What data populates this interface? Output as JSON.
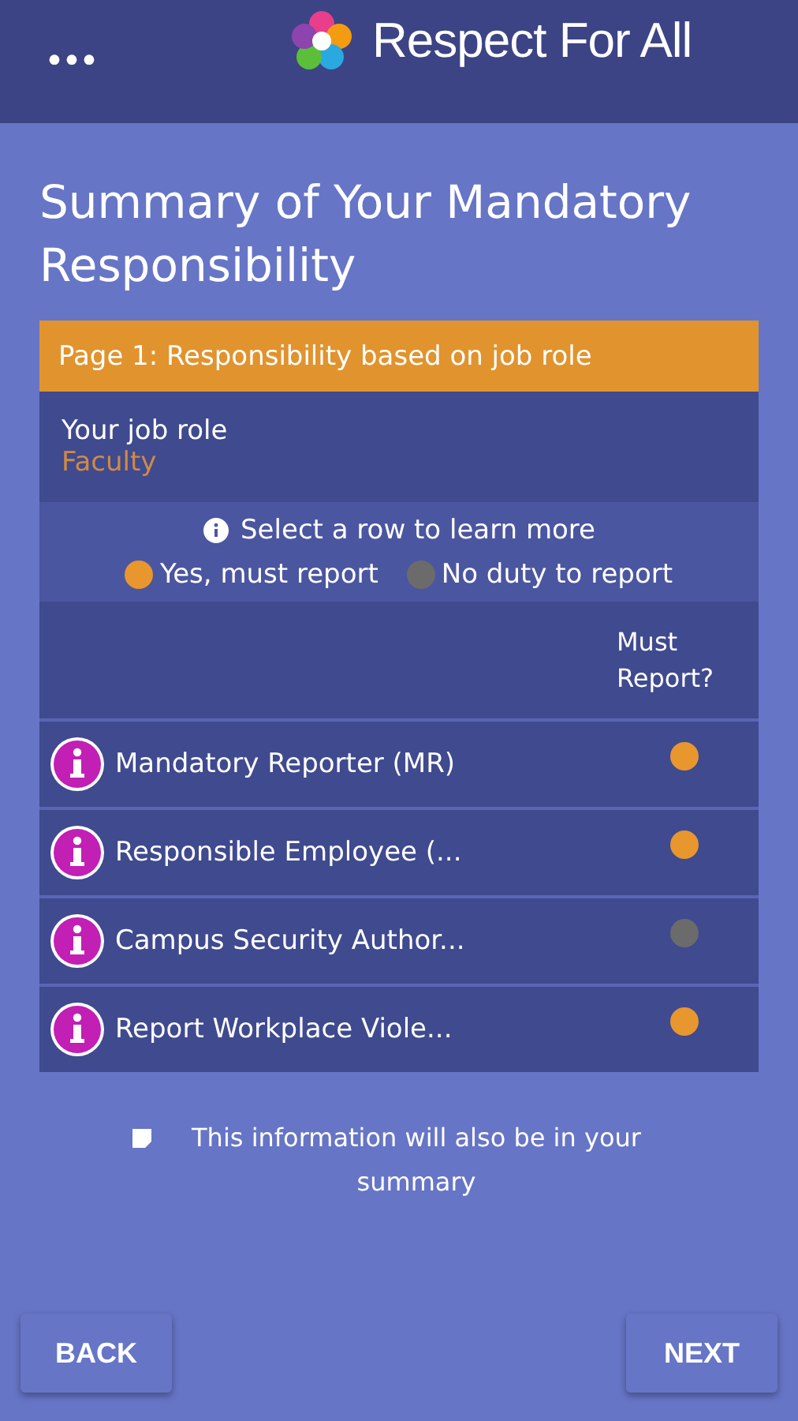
{
  "header": {
    "menu": "•••",
    "app_title": "Respect For All"
  },
  "title": "Summary of Your Mandatory Responsibility",
  "card": {
    "page_heading": "Page 1: Responsibility based on job role",
    "job_role_label": "Your job role",
    "job_role": "Faculty",
    "hint": "Select a row to learn more",
    "legend": [
      {
        "label": "Yes, must report",
        "color": "#e8962e"
      },
      {
        "label": "No duty to report",
        "color": "#6b6b6b"
      }
    ],
    "column_header": "Must Report?",
    "rows": [
      {
        "label": "Mandatory Reporter (MR)",
        "color": "#e8962e"
      },
      {
        "label": "Responsible Employee (...",
        "color": "#e8962e"
      },
      {
        "label": "Campus Security Author...",
        "color": "#6b6b6b"
      },
      {
        "label": "Report Workplace Viole...",
        "color": "#e8962e"
      }
    ]
  },
  "note": "This information will also be in your summary",
  "buttons": {
    "back": "BACK",
    "next": "NEXT"
  }
}
